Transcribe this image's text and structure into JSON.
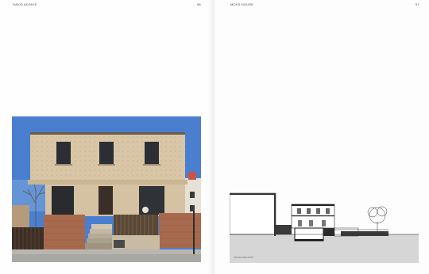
{
  "spread": {
    "left_page": {
      "header_left": "DAVID ADJAYE",
      "page_number": "56"
    },
    "right_page": {
      "header_left": "MOSS HOUSE",
      "page_number": "57",
      "drawing_caption": "CROSS SECTION"
    }
  },
  "colors": {
    "sky": "#4a7fd0",
    "facade": "#d9c6a6",
    "brick": "#a86a4e",
    "section_ground": "#d6d6d6"
  }
}
